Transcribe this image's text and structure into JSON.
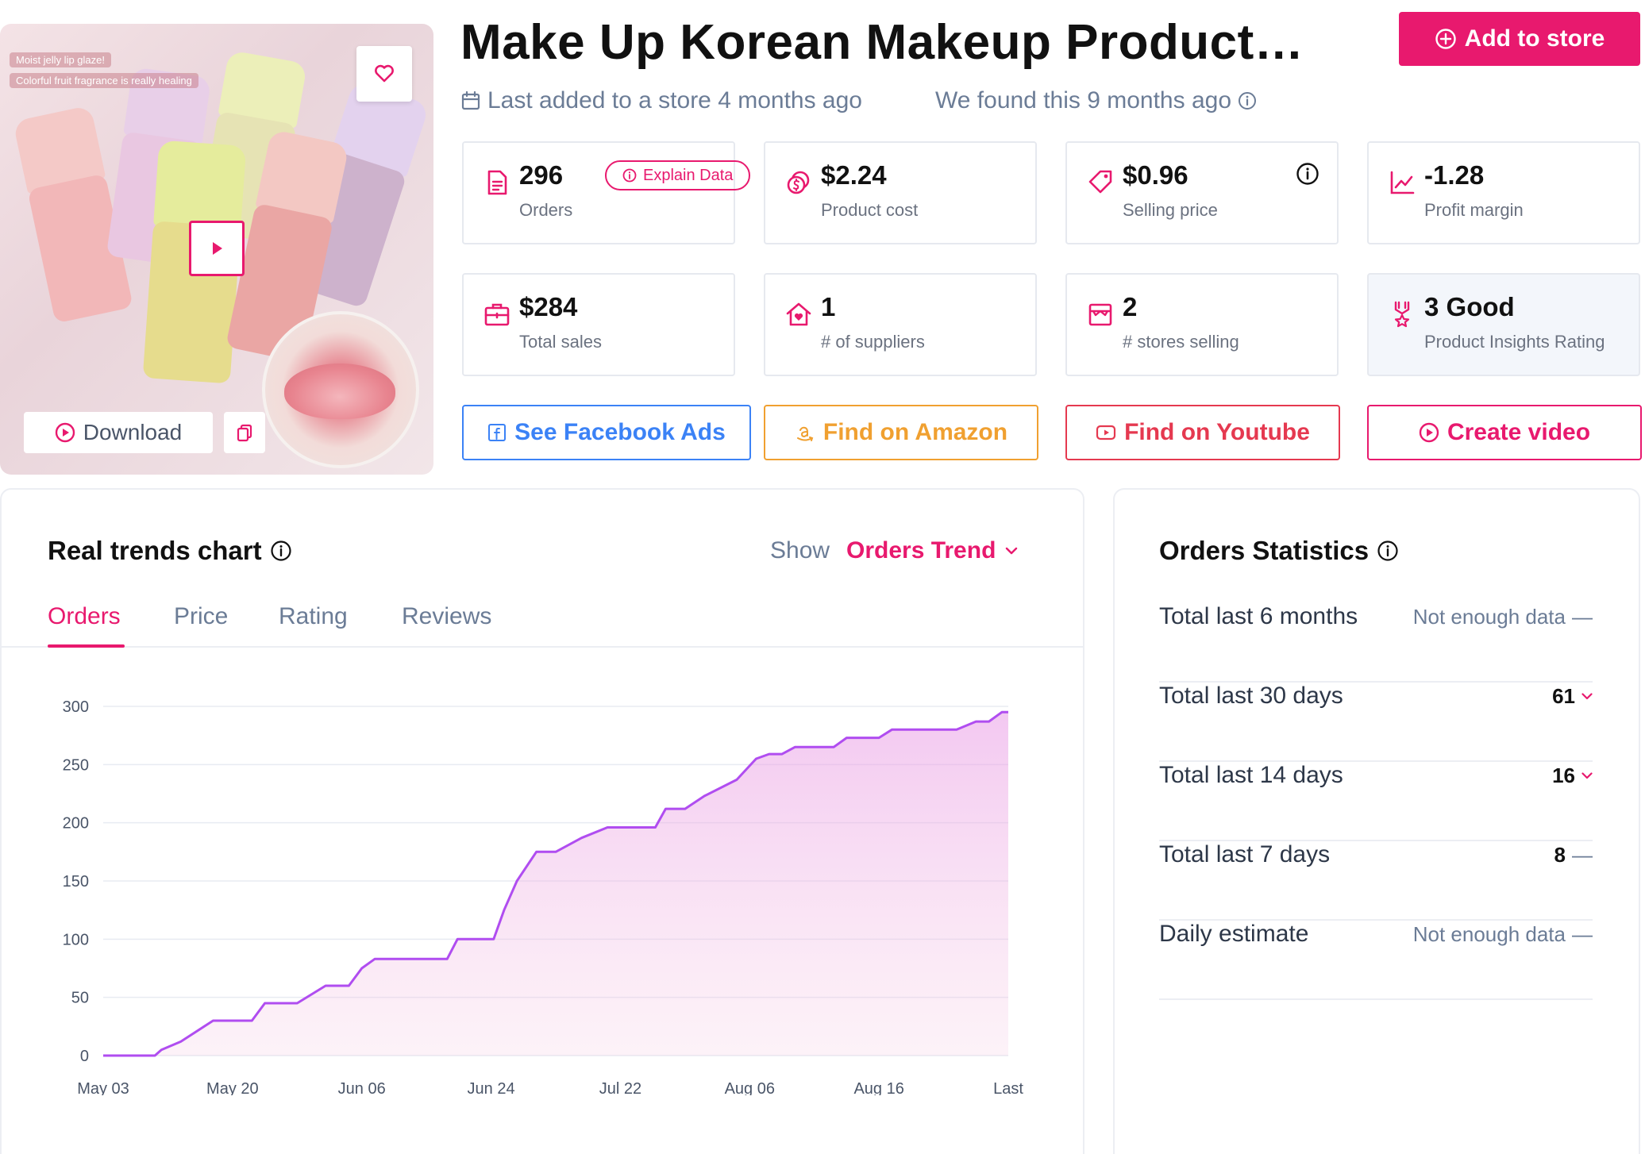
{
  "product": {
    "title": "Make Up Korean Makeup Product…",
    "image_caption_1": "Moist jelly lip glaze!",
    "image_caption_2": "Colorful fruit fragrance is really healing",
    "download_label": "Download"
  },
  "header": {
    "add_to_store": "Add to store",
    "last_added": "Last added to a store 4 months ago",
    "found": "We found this 9 months ago"
  },
  "stats": {
    "orders": {
      "value": "296",
      "label": "Orders",
      "explain": "Explain Data"
    },
    "product_cost": {
      "value": "$2.24",
      "label": "Product cost"
    },
    "selling_price": {
      "value": "$0.96",
      "label": "Selling price"
    },
    "profit_margin": {
      "value": "-1.28",
      "label": "Profit margin"
    },
    "total_sales": {
      "value": "$284",
      "label": "Total sales"
    },
    "suppliers": {
      "value": "1",
      "label": "# of suppliers"
    },
    "stores_selling": {
      "value": "2",
      "label": "# stores selling"
    },
    "rating": {
      "value": "3 Good",
      "label": "Product Insights Rating"
    }
  },
  "actions": {
    "facebook": "See Facebook Ads",
    "amazon": "Find on Amazon",
    "youtube": "Find on Youtube",
    "video": "Create video"
  },
  "trend": {
    "title": "Real trends chart",
    "show_label": "Show",
    "show_value": "Orders Trend",
    "tabs": [
      "Orders",
      "Price",
      "Rating",
      "Reviews"
    ]
  },
  "chart_data": {
    "type": "area",
    "x": [
      "May 03",
      "May 20",
      "Jun 06",
      "Jun 24",
      "Jul 22",
      "Aug 06",
      "Aug 16",
      "Last"
    ],
    "ylim": [
      0,
      300
    ],
    "yticks": [
      0,
      50,
      100,
      150,
      200,
      250,
      300
    ],
    "series": [
      {
        "values": [
          [
            0,
            0
          ],
          [
            0.4,
            0
          ],
          [
            0.45,
            5
          ],
          [
            0.6,
            12
          ],
          [
            0.85,
            30
          ],
          [
            1.15,
            30
          ],
          [
            1.25,
            45
          ],
          [
            1.5,
            45
          ],
          [
            1.72,
            60
          ],
          [
            1.9,
            60
          ],
          [
            2.0,
            75
          ],
          [
            2.1,
            83
          ],
          [
            2.3,
            83
          ],
          [
            2.66,
            83
          ],
          [
            2.74,
            100
          ],
          [
            3.02,
            100
          ],
          [
            3.1,
            125
          ],
          [
            3.2,
            150
          ],
          [
            3.35,
            175
          ],
          [
            3.5,
            175
          ],
          [
            3.7,
            187
          ],
          [
            3.9,
            196
          ],
          [
            4.0,
            196
          ],
          [
            4.27,
            196
          ],
          [
            4.35,
            212
          ],
          [
            4.5,
            212
          ],
          [
            4.65,
            223
          ],
          [
            4.9,
            237
          ],
          [
            5.05,
            255
          ],
          [
            5.15,
            259
          ],
          [
            5.25,
            259
          ],
          [
            5.35,
            265
          ],
          [
            5.65,
            265
          ],
          [
            5.75,
            273
          ],
          [
            6.0,
            273
          ],
          [
            6.1,
            280
          ],
          [
            6.5,
            280
          ],
          [
            6.6,
            280
          ],
          [
            6.75,
            287
          ],
          [
            6.85,
            287
          ],
          [
            6.95,
            295
          ],
          [
            7.0,
            295
          ]
        ]
      }
    ],
    "fill_color": "#ea9be4",
    "line_color": "#b04df0"
  },
  "statistics": {
    "title": "Orders Statistics",
    "rows": [
      {
        "label": "Total last 6 months",
        "value": "Not enough data",
        "trend": "—"
      },
      {
        "label": "Total last 30 days",
        "value": "61",
        "trend": "down"
      },
      {
        "label": "Total last 14 days",
        "value": "16",
        "trend": "down"
      },
      {
        "label": "Total last 7 days",
        "value": "8",
        "trend": "—"
      },
      {
        "label": "Daily estimate",
        "value": "Not enough data",
        "trend": "—"
      }
    ]
  },
  "colors": {
    "accent": "#e8196e",
    "facebook": "#3b82f6",
    "amazon": "#f0a030",
    "youtube": "#e53950"
  }
}
